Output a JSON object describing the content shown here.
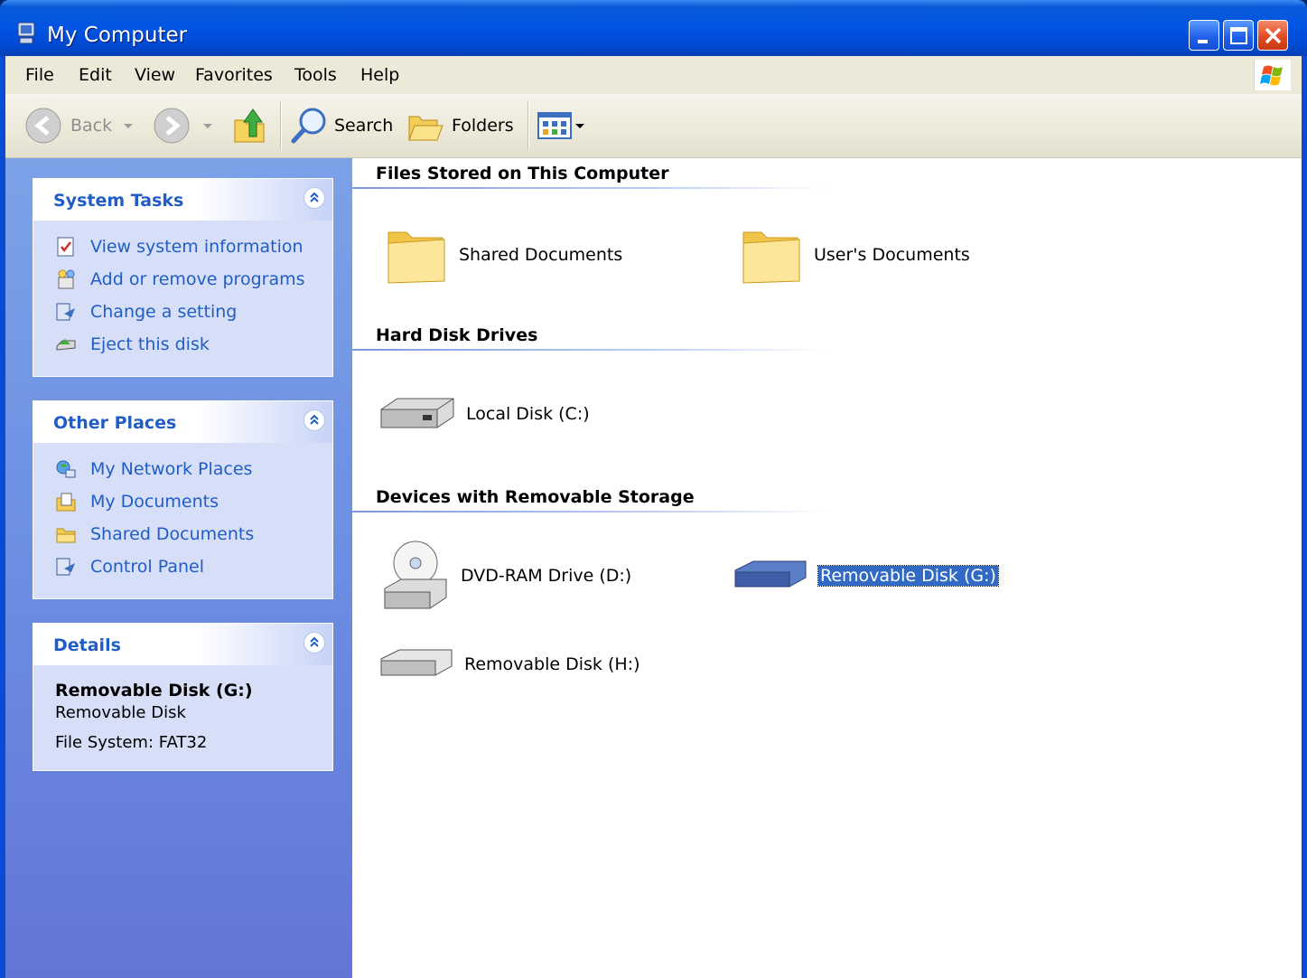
{
  "window": {
    "title": "My Computer"
  },
  "menu": [
    "File",
    "Edit",
    "View",
    "Favorites",
    "Tools",
    "Help"
  ],
  "toolbar": {
    "back_label": "Back",
    "search_label": "Search",
    "folders_label": "Folders"
  },
  "sidebar": {
    "system_tasks": {
      "title": "System Tasks",
      "items": [
        {
          "label": "View system information",
          "icon": "system-info-icon"
        },
        {
          "label": "Add or remove programs",
          "icon": "add-remove-programs-icon"
        },
        {
          "label": "Change a setting",
          "icon": "control-panel-icon"
        },
        {
          "label": "Eject this disk",
          "icon": "eject-disk-icon"
        }
      ]
    },
    "other_places": {
      "title": "Other Places",
      "items": [
        {
          "label": "My Network Places",
          "icon": "network-places-icon"
        },
        {
          "label": "My Documents",
          "icon": "my-documents-icon"
        },
        {
          "label": "Shared Documents",
          "icon": "folder-icon"
        },
        {
          "label": "Control Panel",
          "icon": "control-panel-icon"
        }
      ]
    },
    "details": {
      "title": "Details",
      "name": "Removable Disk (G:)",
      "type": "Removable Disk",
      "file_system": "File System: FAT32"
    }
  },
  "content": {
    "groups": [
      {
        "title": "Files Stored on This Computer",
        "items": [
          {
            "label": "Shared Documents",
            "icon": "folder-icon"
          },
          {
            "label": "User's Documents",
            "icon": "folder-icon"
          }
        ]
      },
      {
        "title": "Hard Disk Drives",
        "items": [
          {
            "label": "Local Disk (C:)",
            "icon": "hard-disk-icon"
          }
        ]
      },
      {
        "title": "Devices with Removable Storage",
        "items": [
          {
            "label": "DVD-RAM Drive (D:)",
            "icon": "dvd-drive-icon"
          },
          {
            "label": "Removable Disk (G:)",
            "icon": "removable-disk-icon",
            "selected": true
          },
          {
            "label": "Removable Disk (H:)",
            "icon": "removable-disk-icon"
          }
        ]
      }
    ]
  },
  "colors": {
    "titlebar": "#0054e3",
    "link": "#215dc6",
    "selection": "#316ac5",
    "sidebar_bg": "#6b8ee2"
  }
}
